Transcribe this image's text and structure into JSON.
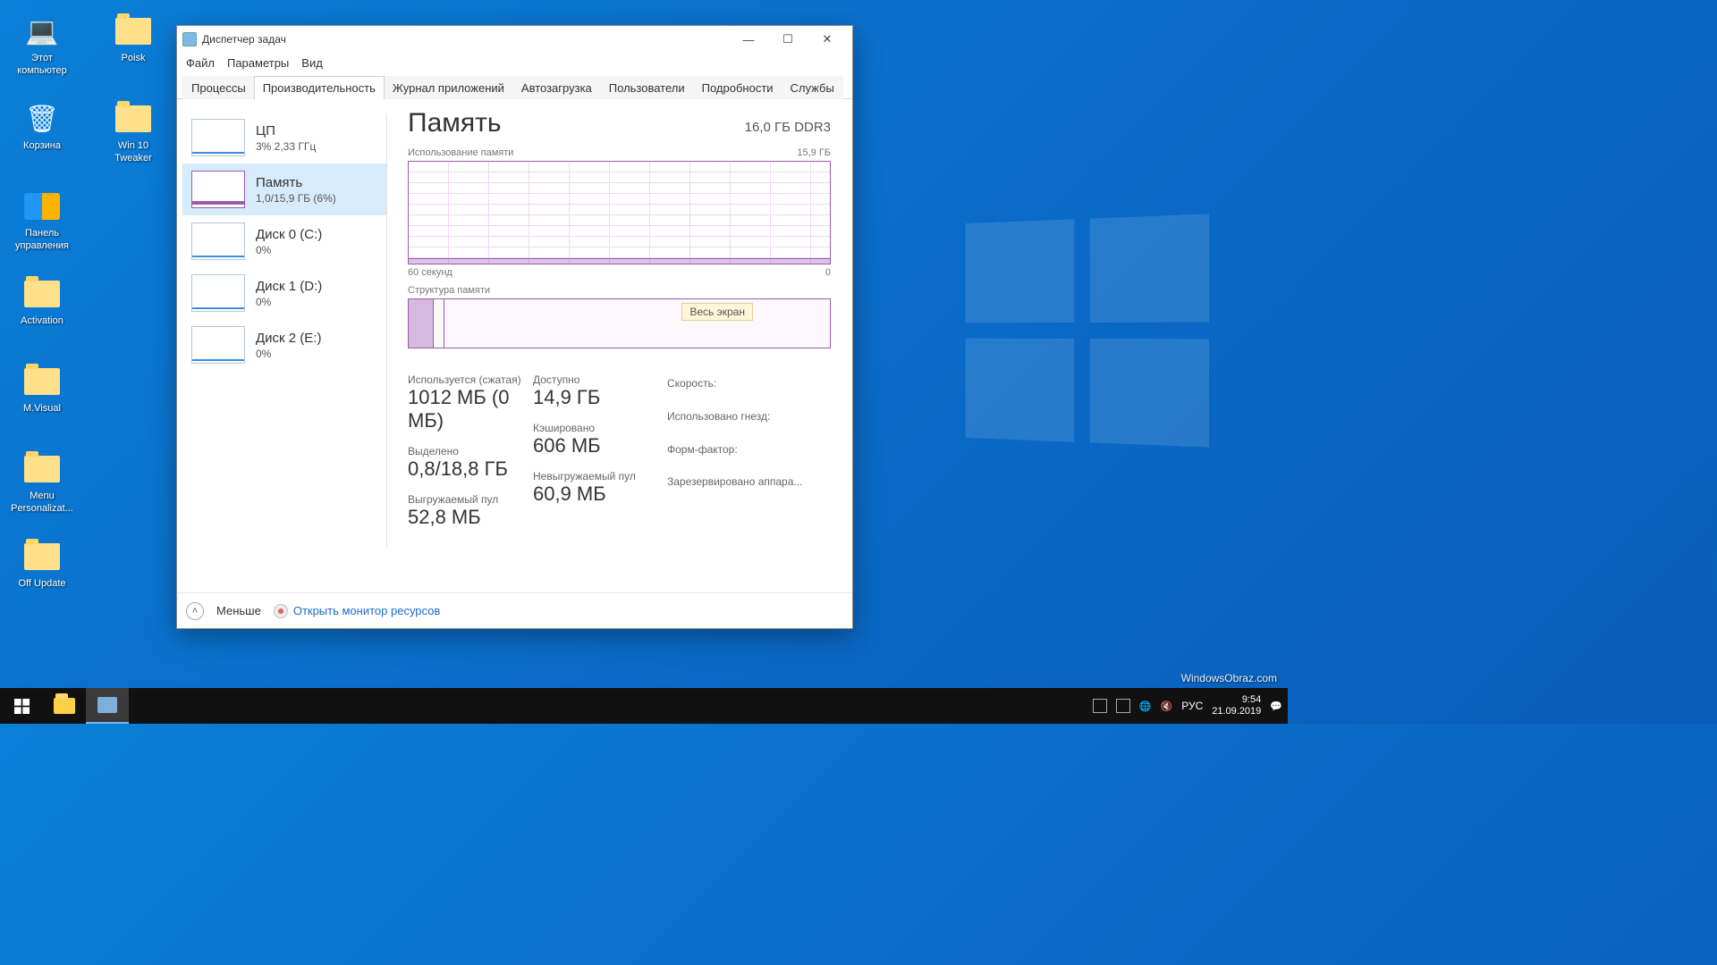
{
  "desktop_icons": [
    {
      "label": "Этот компьютер",
      "type": "pc"
    },
    {
      "label": "Корзина",
      "type": "bin"
    },
    {
      "label": "Панель управления",
      "type": "panel"
    },
    {
      "label": "Activation",
      "type": "folder"
    },
    {
      "label": "M.Visual",
      "type": "folder"
    },
    {
      "label": "Menu Personalizat...",
      "type": "folder"
    },
    {
      "label": "Off Update",
      "type": "folder"
    },
    {
      "label": "Poisk",
      "type": "folder"
    },
    {
      "label": "Win 10 Tweaker",
      "type": "folder"
    }
  ],
  "tm": {
    "title": "Диспетчер задач",
    "menu": [
      "Файл",
      "Параметры",
      "Вид"
    ],
    "tabs": [
      "Процессы",
      "Производительность",
      "Журнал приложений",
      "Автозагрузка",
      "Пользователи",
      "Подробности",
      "Службы"
    ],
    "active_tab": 1,
    "side": [
      {
        "name": "ЦП",
        "value": "3%  2,33 ГГц"
      },
      {
        "name": "Память",
        "value": "1,0/15,9 ГБ (6%)",
        "selected": true
      },
      {
        "name": "Диск 0 (C:)",
        "value": "0%"
      },
      {
        "name": "Диск 1 (D:)",
        "value": "0%"
      },
      {
        "name": "Диск 2 (E:)",
        "value": "0%"
      }
    ],
    "main": {
      "title": "Память",
      "meta": "16,0 ГБ DDR3",
      "usage_label": "Использование памяти",
      "usage_max": "15,9 ГБ",
      "x_left": "60 секунд",
      "x_right": "0",
      "struct_label": "Структура памяти",
      "tooltip": "Весь экран",
      "stats": {
        "used_k": "Используется (сжатая)",
        "used_v": "1012 МБ (0 МБ)",
        "avail_k": "Доступно",
        "avail_v": "14,9 ГБ",
        "commit_k": "Выделено",
        "commit_v": "0,8/18,8 ГБ",
        "cached_k": "Кэшировано",
        "cached_v": "606 МБ",
        "paged_k": "Выгружаемый пул",
        "paged_v": "52,8 МБ",
        "nonpaged_k": "Невыгружаемый пул",
        "nonpaged_v": "60,9 МБ",
        "speed_k": "Скорость:",
        "slots_k": "Использовано гнезд:",
        "form_k": "Форм-фактор:",
        "reserved_k": "Зарезервировано аппара..."
      }
    },
    "footer": {
      "less": "Меньше",
      "monitor": "Открыть монитор ресурсов"
    }
  },
  "taskbar": {
    "lang": "РУС",
    "time": "9:54",
    "date": "21.09.2019"
  },
  "watermark": "WindowsObraz.com"
}
